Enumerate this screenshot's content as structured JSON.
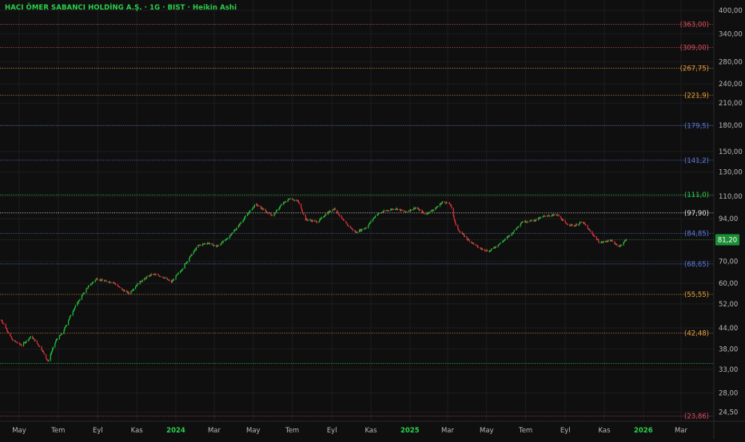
{
  "chart_data": {
    "type": "candlestick",
    "title": "HACI ÖMER SABANCI HOLDİNG A.Ş. · 1G · BIST · Heikin Ashi",
    "scale": "log",
    "y_axis": {
      "ticks": [
        400,
        340,
        280,
        240,
        210,
        180,
        150,
        130,
        110,
        94,
        81.2,
        70,
        60,
        52,
        44,
        38,
        33,
        28,
        24.5
      ],
      "tick_labels": [
        "400,00",
        "340,00",
        "280,00",
        "240,00",
        "210,00",
        "180,00",
        "150,00",
        "130,00",
        "110,00",
        "94,00",
        "81,20",
        "70,00",
        "60,00",
        "52,00",
        "44,00",
        "38,00",
        "33,00",
        "28,00",
        "24,50"
      ],
      "current_price": 81.2,
      "current_price_label": "81,20",
      "range": [
        23,
        430
      ]
    },
    "x_axis": {
      "labels": [
        "May",
        "Tem",
        "Eyl",
        "Kas",
        "2024",
        "Mar",
        "May",
        "Tem",
        "Eyl",
        "Kas",
        "2025",
        "Mar",
        "May",
        "Tem",
        "Eyl",
        "Kas",
        "2026",
        "Mar"
      ],
      "bold_labels": [
        "2024",
        "2025",
        "2026"
      ],
      "label_dates": [
        "2023-05-01",
        "2023-07-01",
        "2023-09-01",
        "2023-11-01",
        "2024-01-01",
        "2024-03-01",
        "2024-05-01",
        "2024-07-01",
        "2024-09-01",
        "2024-11-01",
        "2025-01-01",
        "2025-03-01",
        "2025-05-01",
        "2025-07-01",
        "2025-09-01",
        "2025-11-01",
        "2026-01-01",
        "2026-03-01"
      ]
    },
    "levels": [
      {
        "value": 363.0,
        "label": "(363,00)",
        "color": "#e0505a"
      },
      {
        "value": 309.0,
        "label": "(309,00)",
        "color": "#e0505a"
      },
      {
        "value": 267.75,
        "label": "(267,75)",
        "color": "#e8a23a"
      },
      {
        "value": 221.9,
        "label": "(221,9)",
        "color": "#e8a23a"
      },
      {
        "value": 179.5,
        "label": "(179,5)",
        "color": "#5b7fe0"
      },
      {
        "value": 141.2,
        "label": "(141,2)",
        "color": "#5b7fe0"
      },
      {
        "value": 111.0,
        "label": "(111,0)",
        "color": "#2bd04a"
      },
      {
        "value": 97.9,
        "label": "(97,90)",
        "color": "#e8e8e8"
      },
      {
        "value": 84.85,
        "label": "(84,85)",
        "color": "#5b7fe0"
      },
      {
        "value": 68.65,
        "label": "(68,65)",
        "color": "#5b7fe0"
      },
      {
        "value": 55.55,
        "label": "(55,55)",
        "color": "#e8a23a"
      },
      {
        "value": 42.48,
        "label": "(42,48)",
        "color": "#e8a23a"
      },
      {
        "value": 34.4,
        "label": "",
        "color": "#2bd04a"
      },
      {
        "value": 23.86,
        "label": "(23,86)",
        "color": "#e0505a"
      }
    ],
    "series": [
      {
        "price_path": [
          {
            "date": "2023-04-03",
            "price": 46.5
          },
          {
            "date": "2023-04-20",
            "price": 40.5
          },
          {
            "date": "2023-05-05",
            "price": 39.0
          },
          {
            "date": "2023-05-20",
            "price": 41.5
          },
          {
            "date": "2023-06-05",
            "price": 38.0
          },
          {
            "date": "2023-06-15",
            "price": 34.8
          },
          {
            "date": "2023-06-28",
            "price": 40.5
          },
          {
            "date": "2023-07-08",
            "price": 42.5
          },
          {
            "date": "2023-07-25",
            "price": 50.0
          },
          {
            "date": "2023-08-15",
            "price": 58.0
          },
          {
            "date": "2023-08-30",
            "price": 62.0
          },
          {
            "date": "2023-09-10",
            "price": 61.0
          },
          {
            "date": "2023-09-25",
            "price": 60.5
          },
          {
            "date": "2023-10-08",
            "price": 57.5
          },
          {
            "date": "2023-10-20",
            "price": 56.0
          },
          {
            "date": "2023-11-05",
            "price": 60.5
          },
          {
            "date": "2023-11-25",
            "price": 64.0
          },
          {
            "date": "2023-12-10",
            "price": 63.0
          },
          {
            "date": "2023-12-25",
            "price": 60.5
          },
          {
            "date": "2024-01-10",
            "price": 66.0
          },
          {
            "date": "2024-01-25",
            "price": 73.0
          },
          {
            "date": "2024-02-05",
            "price": 78.0
          },
          {
            "date": "2024-02-20",
            "price": 79.5
          },
          {
            "date": "2024-03-05",
            "price": 77.5
          },
          {
            "date": "2024-03-20",
            "price": 81.5
          },
          {
            "date": "2024-04-05",
            "price": 88.0
          },
          {
            "date": "2024-04-22",
            "price": 97.0
          },
          {
            "date": "2024-05-05",
            "price": 104.0
          },
          {
            "date": "2024-05-20",
            "price": 99.0
          },
          {
            "date": "2024-06-01",
            "price": 96.0
          },
          {
            "date": "2024-06-15",
            "price": 104.0
          },
          {
            "date": "2024-06-28",
            "price": 108.5
          },
          {
            "date": "2024-07-10",
            "price": 106.0
          },
          {
            "date": "2024-07-22",
            "price": 93.5
          },
          {
            "date": "2024-08-10",
            "price": 92.0
          },
          {
            "date": "2024-08-25",
            "price": 98.0
          },
          {
            "date": "2024-09-05",
            "price": 101.0
          },
          {
            "date": "2024-09-20",
            "price": 92.0
          },
          {
            "date": "2024-10-08",
            "price": 85.5
          },
          {
            "date": "2024-10-25",
            "price": 88.5
          },
          {
            "date": "2024-11-10",
            "price": 97.0
          },
          {
            "date": "2024-11-25",
            "price": 99.5
          },
          {
            "date": "2024-12-10",
            "price": 101.0
          },
          {
            "date": "2024-12-25",
            "price": 98.5
          },
          {
            "date": "2025-01-10",
            "price": 101.5
          },
          {
            "date": "2025-01-25",
            "price": 97.0
          },
          {
            "date": "2025-02-10",
            "price": 101.0
          },
          {
            "date": "2025-02-22",
            "price": 106.0
          },
          {
            "date": "2025-03-05",
            "price": 104.0
          },
          {
            "date": "2025-03-15",
            "price": 88.0
          },
          {
            "date": "2025-04-01",
            "price": 81.5
          },
          {
            "date": "2025-04-20",
            "price": 76.5
          },
          {
            "date": "2025-05-05",
            "price": 75.0
          },
          {
            "date": "2025-05-25",
            "price": 80.0
          },
          {
            "date": "2025-06-10",
            "price": 85.0
          },
          {
            "date": "2025-06-25",
            "price": 92.0
          },
          {
            "date": "2025-07-15",
            "price": 93.0
          },
          {
            "date": "2025-08-01",
            "price": 96.0
          },
          {
            "date": "2025-08-20",
            "price": 96.5
          },
          {
            "date": "2025-09-01",
            "price": 91.0
          },
          {
            "date": "2025-09-15",
            "price": 89.5
          },
          {
            "date": "2025-09-28",
            "price": 92.0
          },
          {
            "date": "2025-10-10",
            "price": 86.0
          },
          {
            "date": "2025-10-25",
            "price": 79.5
          },
          {
            "date": "2025-11-10",
            "price": 81.0
          },
          {
            "date": "2025-11-25",
            "price": 77.5
          },
          {
            "date": "2025-12-05",
            "price": 81.2
          }
        ]
      }
    ],
    "colors": {
      "up": "#1fc23a",
      "down": "#e0303a",
      "grid": "#1d1d1f",
      "axis_text": "#b8b8b8",
      "background": "#0f0f10",
      "price_badge": "#1b8f36"
    }
  }
}
